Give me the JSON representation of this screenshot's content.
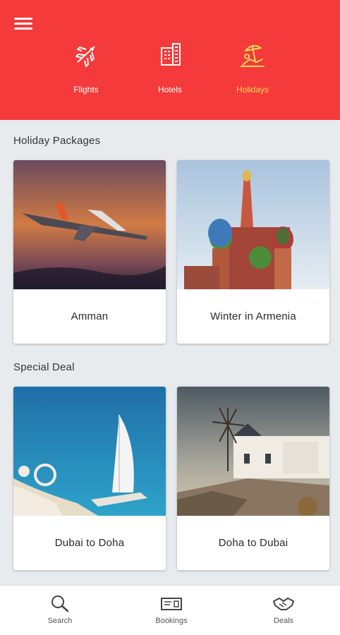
{
  "header": {
    "tabs": [
      {
        "label": "Flights",
        "icon": "airplane-icon",
        "active": false
      },
      {
        "label": "Hotels",
        "icon": "building-icon",
        "active": false
      },
      {
        "label": "Holidays",
        "icon": "beach-icon",
        "active": true
      }
    ],
    "brand_color": "#f43a3a",
    "active_color": "#ffd85a"
  },
  "sections": [
    {
      "title": "Holiday Packages",
      "cards": [
        {
          "caption": "Amman",
          "image": "airplane-sunset-photo"
        },
        {
          "caption": "Winter in Armenia",
          "image": "onion-domes-cathedral-photo"
        }
      ]
    },
    {
      "title": "Special Deal",
      "cards": [
        {
          "caption": "Dubai to Doha",
          "image": "sail-hotel-coast-photo"
        },
        {
          "caption": "Doha to Dubai",
          "image": "windmill-whitewashed-town-photo"
        }
      ]
    }
  ],
  "bottom_nav": [
    {
      "label": "Search",
      "icon": "search-icon"
    },
    {
      "label": "Bookings",
      "icon": "ticket-icon"
    },
    {
      "label": "Deals",
      "icon": "handshake-icon"
    }
  ]
}
